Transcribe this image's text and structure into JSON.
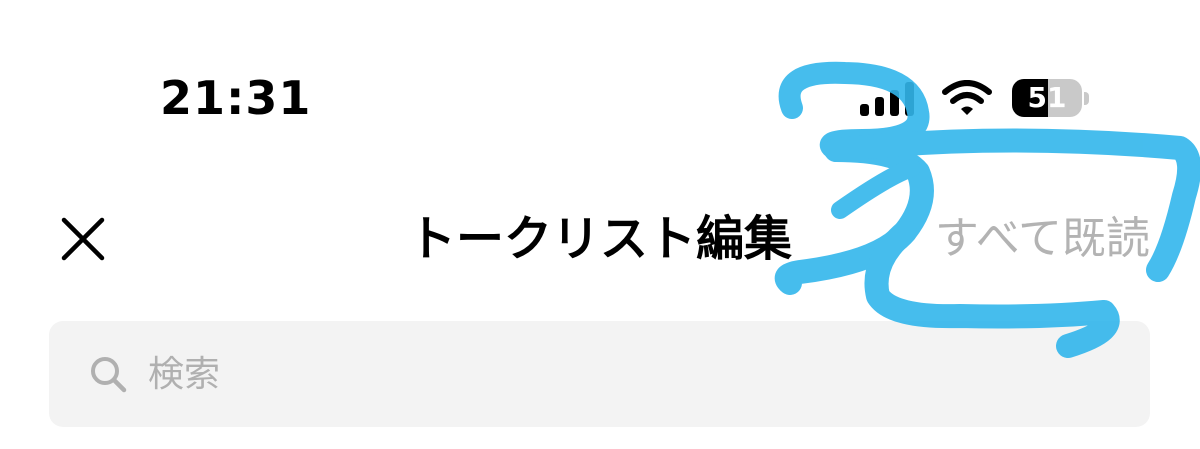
{
  "status_bar": {
    "time": "21:31",
    "battery_level": "51",
    "battery_fraction": 0.51,
    "icons": [
      "signal-icon",
      "wifi-icon",
      "battery-icon"
    ]
  },
  "header": {
    "title": "トークリスト編集",
    "close_icon": "close-icon",
    "mark_all_read_label": "すべて既読"
  },
  "search": {
    "placeholder": "検索",
    "value": "",
    "icon": "search-icon"
  },
  "colors": {
    "background": "#ffffff",
    "text": "#000000",
    "disabled_text": "#b3b3b3",
    "search_background": "#f3f3f3",
    "annotation": "#32b6ec"
  }
}
